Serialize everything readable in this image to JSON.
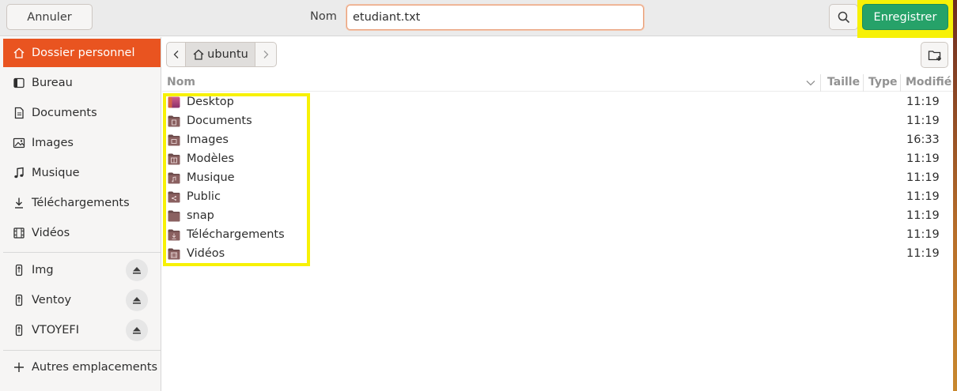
{
  "header": {
    "cancel_label": "Annuler",
    "name_label": "Nom",
    "filename_value": "etudiant.txt",
    "save_label": "Enregistrer",
    "search_icon": "search-icon"
  },
  "sidebar": {
    "places": [
      {
        "label": "Dossier personnel",
        "icon": "home-icon",
        "active": true
      },
      {
        "label": "Bureau",
        "icon": "desktop-icon"
      },
      {
        "label": "Documents",
        "icon": "document-icon"
      },
      {
        "label": "Images",
        "icon": "image-icon"
      },
      {
        "label": "Musique",
        "icon": "music-icon"
      },
      {
        "label": "Téléchargements",
        "icon": "download-icon"
      },
      {
        "label": "Vidéos",
        "icon": "video-icon"
      }
    ],
    "devices": [
      {
        "label": "Img",
        "icon": "usb-drive-icon"
      },
      {
        "label": "Ventoy",
        "icon": "usb-drive-icon"
      },
      {
        "label": "VTOYEFI",
        "icon": "usb-drive-icon"
      }
    ],
    "other_locations": "Autres emplacements"
  },
  "pathbar": {
    "current": "ubuntu"
  },
  "columns": {
    "name": "Nom",
    "size": "Taille",
    "type": "Type",
    "modified": "Modifié"
  },
  "files": [
    {
      "name": "Desktop",
      "time": "11:19",
      "icon": "desktop-folder-icon"
    },
    {
      "name": "Documents",
      "time": "11:19",
      "icon": "documents-folder-icon"
    },
    {
      "name": "Images",
      "time": "16:33",
      "icon": "pictures-folder-icon"
    },
    {
      "name": "Modèles",
      "time": "11:19",
      "icon": "templates-folder-icon"
    },
    {
      "name": "Musique",
      "time": "11:19",
      "icon": "music-folder-icon"
    },
    {
      "name": "Public",
      "time": "11:19",
      "icon": "public-folder-icon"
    },
    {
      "name": "snap",
      "time": "11:19",
      "icon": "folder-icon"
    },
    {
      "name": "Téléchargements",
      "time": "11:19",
      "icon": "downloads-folder-icon"
    },
    {
      "name": "Vidéos",
      "time": "11:19",
      "icon": "videos-folder-icon"
    }
  ],
  "colors": {
    "accent": "#e95420",
    "save_button": "#26a269",
    "highlight": "#f7f106"
  }
}
